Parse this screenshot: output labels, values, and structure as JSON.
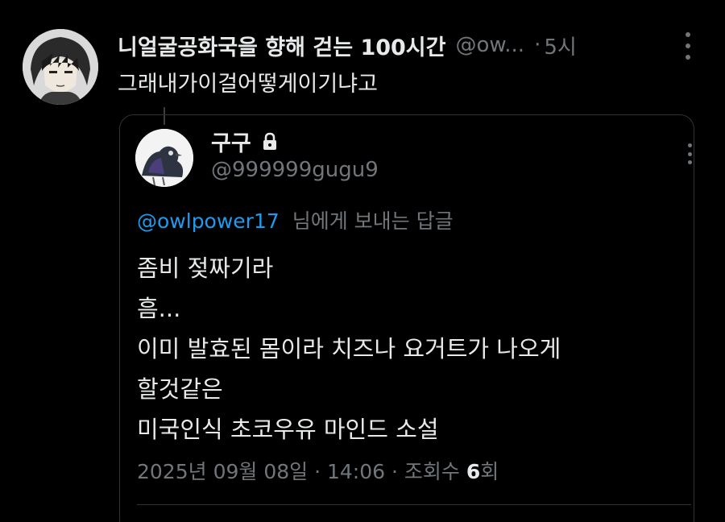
{
  "tweet": {
    "author_name": "니얼굴공화국을 향해 걷는 100시간",
    "author_handle": "@ow...",
    "separator": "·",
    "time": "5시",
    "text": "그래내가이걸어떻게이기냐고"
  },
  "quoted": {
    "author_name": "구구",
    "author_handle": "@999999gugu9",
    "reply_handle": "@owlpower17",
    "reply_suffix": "님에게 보내는 답글",
    "lines": [
      "좀비 젖짜기라",
      "흠...",
      "이미 발효된 몸이라 치즈나 요거트가 나오게",
      "할것같은",
      "미국인식 초코우유 마인드 소설"
    ],
    "meta": {
      "date": "2025년 09월 08일 · 14:06 · 조회수 ",
      "views_count": "6",
      "views_suffix": "회"
    }
  },
  "colors": {
    "background": "#000000",
    "text": "#e7e9ea",
    "muted": "#71767b",
    "link": "#1d9bf0",
    "border": "#2f3336"
  },
  "icons": [
    "more-icon",
    "lock-icon"
  ]
}
